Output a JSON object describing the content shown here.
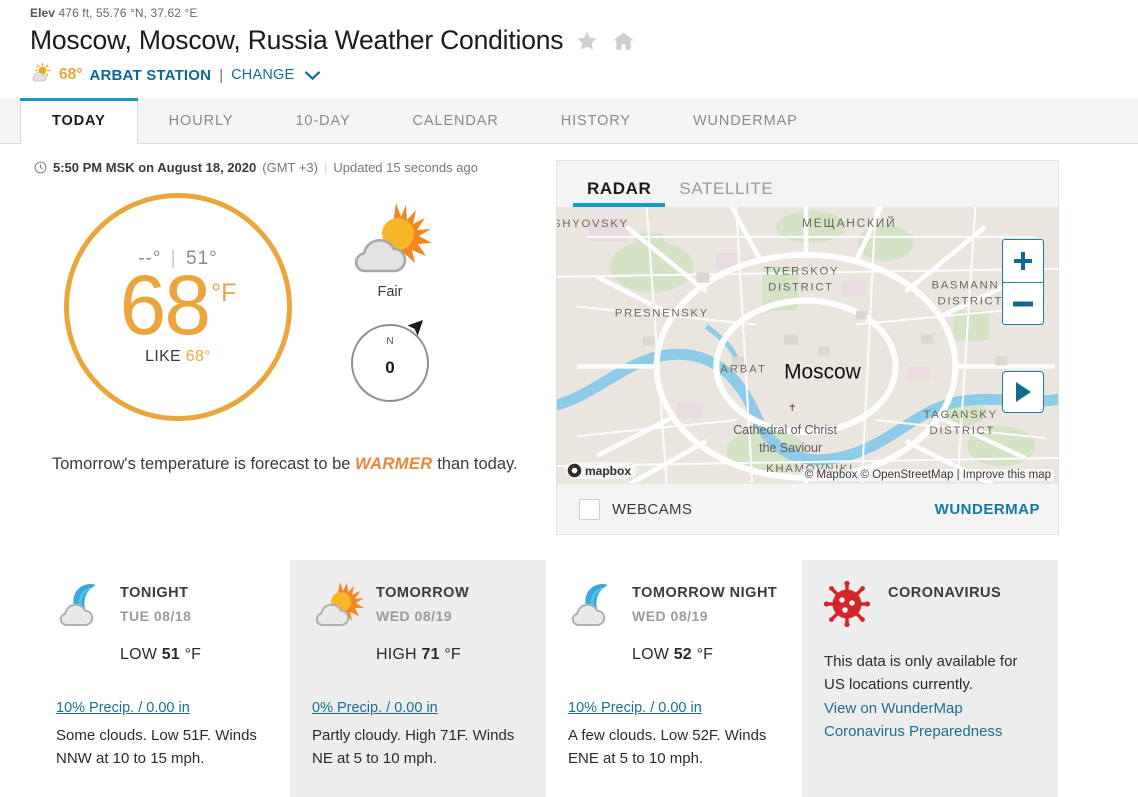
{
  "header": {
    "elevation_line": "Elev 476 ft, 55.76 °N, 37.62 °E",
    "elev_label": "Elev",
    "elev_value": "476 ft, 55.76 °N, 37.62 °E",
    "title": "Moscow, Moscow, Russia Weather Conditions",
    "favorite_icon": "star-icon",
    "home_icon": "home-icon",
    "station": {
      "icon": "partly-sunny-icon",
      "temp": "68°",
      "name": "ARBAT STATION",
      "separator": "|",
      "change_label": "CHANGE",
      "caret_icon": "chevron-down-icon"
    }
  },
  "tabs": [
    {
      "label": "TODAY",
      "active": true
    },
    {
      "label": "HOURLY",
      "active": false
    },
    {
      "label": "10-DAY",
      "active": false
    },
    {
      "label": "CALENDAR",
      "active": false
    },
    {
      "label": "HISTORY",
      "active": false
    },
    {
      "label": "WUNDERMAP",
      "active": false
    }
  ],
  "observation": {
    "clock_icon": "clock-icon",
    "time": "5:50 PM MSK on August 18, 2020",
    "gmt": "(GMT +3)",
    "divider": "|",
    "updated": "Updated 15 seconds ago"
  },
  "current": {
    "high": "--°",
    "bar": "|",
    "low": "51°",
    "temperature": "68",
    "unit": "°F",
    "feels_like_label": "LIKE",
    "feels_like_value": "68°",
    "condition_icon": "partly-sunny-icon",
    "condition": "Fair",
    "wind": {
      "direction_label": "N",
      "speed": "0",
      "arrow_icon": "wind-arrow-icon"
    },
    "trend_prefix": "Tomorrow's temperature is forecast to be",
    "trend_word": "WARMER",
    "trend_suffix": "than today."
  },
  "map": {
    "tabs": [
      {
        "label": "RADAR",
        "active": true
      },
      {
        "label": "SATELLITE",
        "active": false
      }
    ],
    "labels": [
      "SHYOVSKY",
      "МЕЩАНСКИЙ",
      "TVERSKOY DISTRICT",
      "BASMANN DISTRICT",
      "PRESNENSKY",
      "ARBAT",
      "Moscow",
      "Cathedral of Christ the Saviour",
      "TAGANSKY DISTRICT",
      "KHAMOVNIKI"
    ],
    "city_label": "Moscow",
    "poi_label": "Cathedral of Christ\nthe Saviour",
    "brand": "mapbox",
    "attribution": "© Mapbox © OpenStreetMap | Improve this map",
    "zoom_in_icon": "plus-icon",
    "zoom_out_icon": "minus-icon",
    "play_icon": "play-icon",
    "webcams_label": "WEBCAMS",
    "webcams_checked": false,
    "wundermap_label": "WUNDERMAP"
  },
  "forecast_cards": [
    {
      "icon": "moon-cloud-icon",
      "title": "TONIGHT",
      "date": "TUE 08/18",
      "temp_label": "LOW",
      "temp_value": "51",
      "temp_unit": "°F",
      "precip": "10% Precip. / 0.00 in",
      "description": "Some clouds. Low 51F. Winds NNW at 10 to 15 mph.",
      "shade": false
    },
    {
      "icon": "sun-cloud-icon",
      "title": "TOMORROW",
      "date": "WED 08/19",
      "temp_label": "HIGH",
      "temp_value": "71",
      "temp_unit": "°F",
      "precip": "0% Precip. / 0.00 in",
      "description": "Partly cloudy. High 71F. Winds NE at 5 to 10 mph.",
      "shade": true
    },
    {
      "icon": "moon-cloud-icon",
      "title": "TOMORROW NIGHT",
      "date": "WED 08/19",
      "temp_label": "LOW",
      "temp_value": "52",
      "temp_unit": "°F",
      "precip": "10% Precip. / 0.00 in",
      "description": "A few clouds. Low 52F. Winds ENE at 5 to 10 mph.",
      "shade": false
    }
  ],
  "coronavirus_card": {
    "icon": "virus-icon",
    "title": "CORONAVIRUS",
    "body": "This data is only available for US locations currently.",
    "link1": "View on WunderMap",
    "link2": "Coronavirus Preparedness",
    "shade": true
  },
  "colors": {
    "accent_orange": "#eaa63c",
    "accent_teal": "#1899c6",
    "link_blue": "#1b6f92",
    "warm_orange": "#e8873d",
    "virus_red": "#d6242b",
    "tab_bg": "#f5f5f5",
    "card_shade": "#ededed"
  }
}
